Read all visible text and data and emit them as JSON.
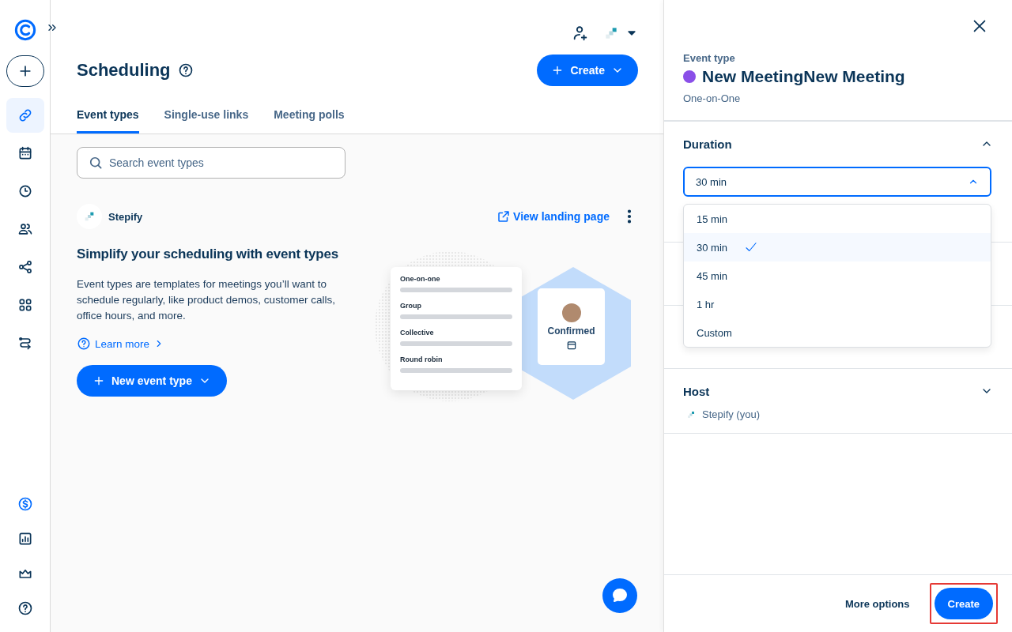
{
  "sidebar": {
    "nav_items": [
      {
        "selected": true
      },
      {
        "selected": false
      },
      {
        "selected": false
      },
      {
        "selected": false
      },
      {
        "selected": false
      },
      {
        "selected": false
      },
      {
        "selected": false
      }
    ]
  },
  "header": {
    "title": "Scheduling",
    "create_button": "Create"
  },
  "tabs": [
    {
      "label": "Event types",
      "selected": true
    },
    {
      "label": "Single-use links",
      "selected": false
    },
    {
      "label": "Meeting polls",
      "selected": false
    }
  ],
  "search": {
    "placeholder": "Search event types"
  },
  "account": {
    "name": "Stepify",
    "link": "View landing page"
  },
  "empty_state": {
    "heading": "Simplify your scheduling with event types",
    "body": "Event types are templates for meetings you’ll want to schedule regularly, like product demos, customer calls, office hours, and more.",
    "link": "Learn more",
    "button": "New event type"
  },
  "illustration": {
    "rows": [
      "One-on-one",
      "Group",
      "Collective",
      "Round robin"
    ],
    "badge": "Confirmed"
  },
  "panel": {
    "label": "Event type",
    "title": "New MeetingNew Meeting",
    "subtitle": "One-on-One",
    "duration": {
      "title": "Duration",
      "expanded": true,
      "value": "30 min",
      "options": [
        {
          "label": "15 min",
          "selected": false
        },
        {
          "label": "30 min",
          "selected": true
        },
        {
          "label": "45 min",
          "selected": false
        },
        {
          "label": "1 hr",
          "selected": false
        },
        {
          "label": "Custom",
          "selected": false
        }
      ]
    },
    "host": {
      "title": "Host",
      "expanded": false,
      "name": "Stepify (you)"
    },
    "footer": {
      "secondary": "More options",
      "primary": "Create"
    }
  }
}
